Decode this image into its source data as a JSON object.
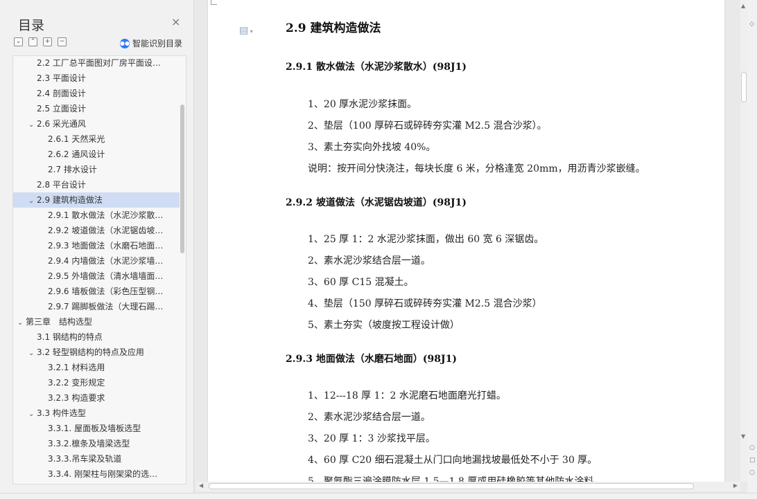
{
  "toc": {
    "title": "目录",
    "close_icon": "×",
    "smart_label": "智能识别目录",
    "tools": [
      "⌄",
      "⌃",
      "+",
      "−"
    ],
    "items": [
      {
        "label": "2.2 工厂总平面图对厂房平面设…",
        "level": 1,
        "caret": ""
      },
      {
        "label": "2.3 平面设计",
        "level": 1,
        "caret": ""
      },
      {
        "label": "2.4 剖面设计",
        "level": 1,
        "caret": ""
      },
      {
        "label": "2.5 立面设计",
        "level": 1,
        "caret": ""
      },
      {
        "label": "2.6 采光通风",
        "level": 1,
        "caret": "⌄"
      },
      {
        "label": "2.6.1 天然采光",
        "level": 2,
        "caret": ""
      },
      {
        "label": "2.6.2 通风设计",
        "level": 2,
        "caret": ""
      },
      {
        "label": "2.7 排水设计",
        "level": 2,
        "caret": ""
      },
      {
        "label": "2.8 平台设计",
        "level": 1,
        "caret": ""
      },
      {
        "label": "2.9 建筑构造做法",
        "level": 1,
        "caret": "⌄",
        "active": true
      },
      {
        "label": "2.9.1 散水做法（水泥沙浆散…",
        "level": 2,
        "caret": ""
      },
      {
        "label": "2.9.2 坡道做法（水泥锯齿坡…",
        "level": 2,
        "caret": ""
      },
      {
        "label": "2.9.3 地面做法（水磨石地面…",
        "level": 2,
        "caret": ""
      },
      {
        "label": "2.9.4 内墙做法（水泥沙浆墙…",
        "level": 2,
        "caret": ""
      },
      {
        "label": "2.9.5 外墙做法（清水墙墙面…",
        "level": 2,
        "caret": ""
      },
      {
        "label": "2.9.6 墙板做法（彩色压型钢…",
        "level": 2,
        "caret": ""
      },
      {
        "label": "2.9.7 踢脚板做法（大理石踢…",
        "level": 2,
        "caret": ""
      },
      {
        "label": "第三章　结构选型",
        "level": 0,
        "caret": "⌄"
      },
      {
        "label": "3.1 钢结构的特点",
        "level": 1,
        "caret": ""
      },
      {
        "label": "3.2 轻型钢结构的特点及应用",
        "level": 1,
        "caret": "⌄"
      },
      {
        "label": "3.2.1 材料选用",
        "level": 2,
        "caret": ""
      },
      {
        "label": "3.2.2 变形规定",
        "level": 2,
        "caret": ""
      },
      {
        "label": "3.2.3 构造要求",
        "level": 2,
        "caret": ""
      },
      {
        "label": "3.3 构件选型",
        "level": 1,
        "caret": "⌄"
      },
      {
        "label": "3.3.1. 屋面板及墙板选型",
        "level": 2,
        "caret": ""
      },
      {
        "label": "3.3.2.檩条及墙梁选型",
        "level": 2,
        "caret": ""
      },
      {
        "label": "3.3.3.吊车梁及轨道",
        "level": 2,
        "caret": ""
      },
      {
        "label": "3.3.4. 刚架柱与刚架梁的选…",
        "level": 2,
        "caret": ""
      }
    ]
  },
  "doc": {
    "heading": "2.9 建筑构造做法",
    "sections": [
      {
        "title": "2.9.1 散水做法（水泥沙浆散水）(98J1)",
        "lines": [
          "1、20 厚水泥沙浆抹面。",
          "2、垫层（100 厚碎石或碎砖夯实灌 M2.5 混合沙浆）。",
          "3、素土夯实向外找坡 40%。",
          "说明：按开间分快浇注，每块长度 6 米，分格逢宽 20mm，用沥青沙浆嵌缝。"
        ]
      },
      {
        "title": "2.9.2 坡道做法（水泥锯齿坡道）(98J1)",
        "lines": [
          "1、25 厚 1：2 水泥沙浆抹面，做出 60 宽 6 深锯齿。",
          "2、素水泥沙浆结合层一道。",
          "3、60 厚 C15 混凝土。",
          "4、垫层（150 厚碎石或碎砖夯实灌 M2.5 混合沙浆）",
          "5、素土夯实（坡度按工程设计做）"
        ]
      },
      {
        "title": "2.9.3 地面做法（水磨石地面）(98J1)",
        "lines": [
          "1、12---18 厚 1：2 水泥磨石地面磨光打蜡。",
          "2、素水泥沙浆结合层一道。",
          "3、20 厚 1：3 沙浆找平层。",
          "4、60 厚 C20 细石混凝土从门口向地漏找坡最低处不小于 30 厚。",
          "5、聚氨酯三遍涂膜防水层 1.5—1.8 厚或用硅橡胶等其他防水涂料"
        ]
      }
    ]
  }
}
